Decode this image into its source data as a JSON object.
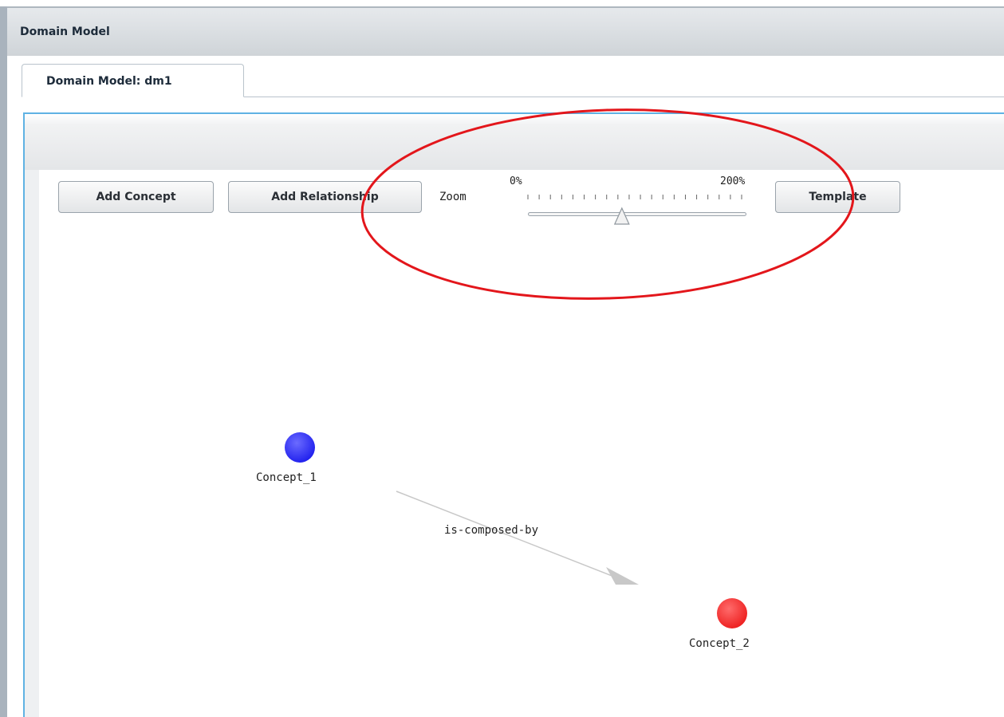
{
  "panel": {
    "title": "Domain Model"
  },
  "tabs": [
    {
      "label": "Domain Model: dm1",
      "active": true
    }
  ],
  "toolbar": {
    "add_concept_label": "Add Concept",
    "add_relationship_label": "Add Relationship",
    "template_label": "Template",
    "zoom": {
      "label": "Zoom",
      "min_label": "0%",
      "max_label": "200%",
      "value_fraction": 0.43
    }
  },
  "graph": {
    "nodes": [
      {
        "id": "n1",
        "label": "Concept_1",
        "color": "#3b3bff"
      },
      {
        "id": "n2",
        "label": "Concept_2",
        "color": "#ff3b3b"
      }
    ],
    "edges": [
      {
        "from": "n1",
        "to": "n2",
        "label": "is-composed-by"
      }
    ]
  },
  "colors": {
    "accent_frame": "#5fb2e3",
    "annotation_ellipse": "#e3161b",
    "edge": "#c8c8c8"
  },
  "icons": {
    "slider_thumb": "triangle-up-icon"
  }
}
